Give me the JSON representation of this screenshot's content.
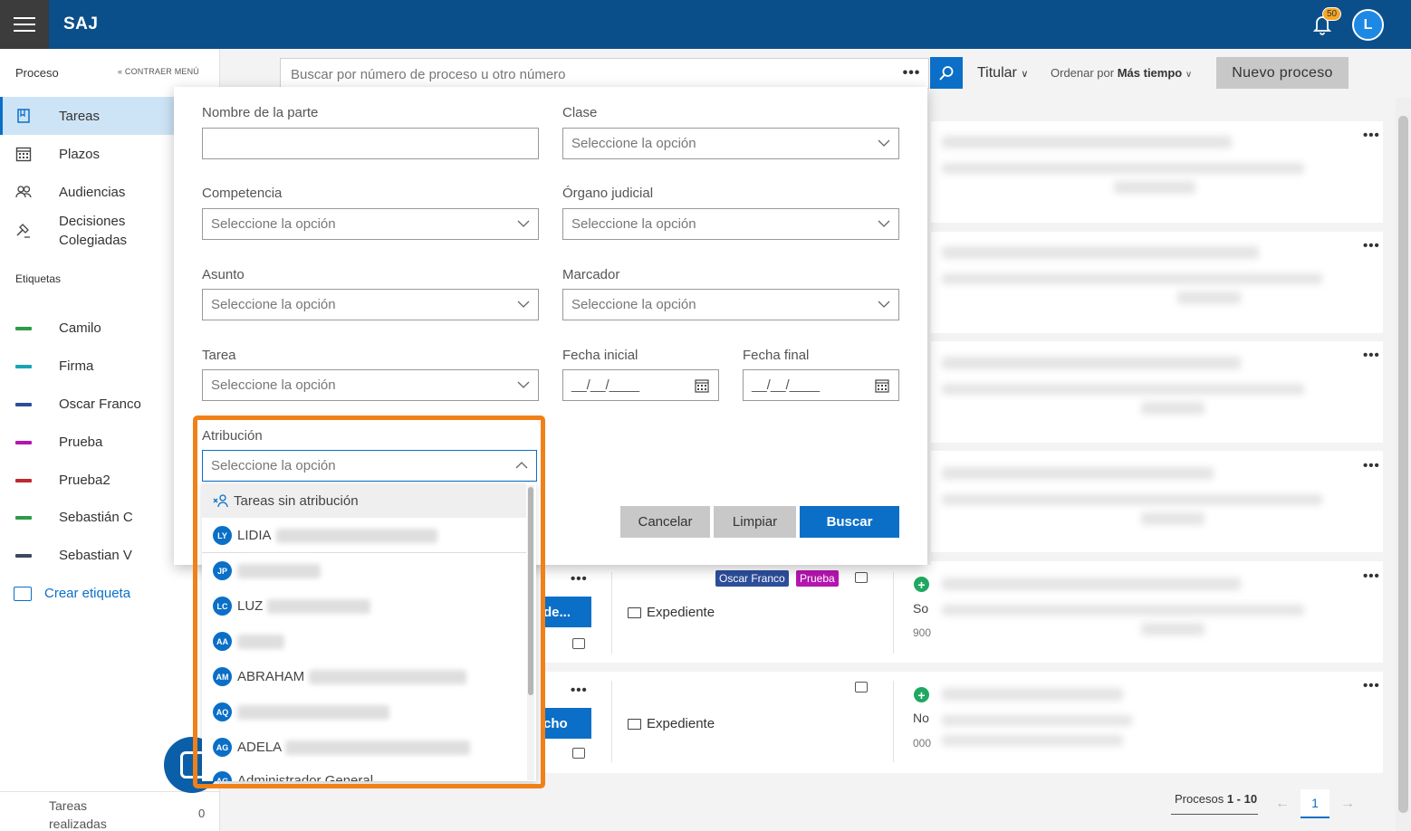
{
  "app": {
    "brand": "SAJ",
    "notifications": "50",
    "user_initial": "L"
  },
  "sidebar": {
    "title": "Proceso",
    "collapse_label": "CONTRAER MENÚ",
    "items": [
      {
        "label": "Tareas"
      },
      {
        "label": "Plazos"
      },
      {
        "label": "Audiencias"
      },
      {
        "label": "Decisiones Colegiadas"
      }
    ],
    "tags_title": "Etiquetas",
    "tags": [
      {
        "label": "Camilo",
        "color": "#2e9b4a"
      },
      {
        "label": "Firma",
        "color": "#1aa3b5"
      },
      {
        "label": "Oscar Franco",
        "color": "#2d4e9a"
      },
      {
        "label": "Prueba",
        "color": "#b515b0"
      },
      {
        "label": "Prueba2",
        "color": "#c0282e"
      },
      {
        "label": "Sebastián C",
        "color": "#2e9b4a"
      },
      {
        "label": "Sebastian V",
        "color": "#3b4a5e"
      }
    ],
    "create_tag": "Crear etiqueta",
    "done_label": "Tareas realizadas",
    "done_count": "0"
  },
  "toolbar": {
    "search_placeholder": "Buscar por número de proceso u otro número",
    "more": "•••",
    "titular": "Titular",
    "order_prefix": "Ordenar por",
    "order_value": "Más tiempo",
    "new_process": "Nuevo proceso"
  },
  "cards": {
    "kebab": "•••",
    "tag_a": "Oscar Franco",
    "tag_b": "Prueba",
    "expediente": "Expediente",
    "btn_a": "de...",
    "btn_b": "cho",
    "text_a": "So",
    "num_a": "900",
    "text_b": "No",
    "num_b": "000"
  },
  "pager": {
    "label": "Procesos",
    "range": "1 - 10",
    "page": "1",
    "prev": "←",
    "next": "→"
  },
  "modal": {
    "fields": {
      "party_name": {
        "label": "Nombre de la parte",
        "value": ""
      },
      "clase": {
        "label": "Clase",
        "placeholder": "Seleccione la opción"
      },
      "competencia": {
        "label": "Competencia",
        "placeholder": "Seleccione la opción"
      },
      "organo": {
        "label": "Órgano judicial",
        "placeholder": "Seleccione la opción"
      },
      "asunto": {
        "label": "Asunto",
        "placeholder": "Seleccione la opción"
      },
      "marcador": {
        "label": "Marcador",
        "placeholder": "Seleccione la opción"
      },
      "tarea": {
        "label": "Tarea",
        "placeholder": "Seleccione la opción"
      },
      "fecha_inicial": {
        "label": "Fecha inicial",
        "placeholder": "__/__/____"
      },
      "fecha_final": {
        "label": "Fecha final",
        "placeholder": "__/__/____"
      },
      "atribucion": {
        "label": "Atribución",
        "placeholder": "Seleccione la opción"
      }
    },
    "buttons": {
      "cancel": "Cancelar",
      "clear": "Limpiar",
      "search": "Buscar"
    },
    "dropdown": {
      "no_assignment": "Tareas sin atribución",
      "options": [
        {
          "initials": "LY",
          "name": "LIDIA"
        },
        {
          "initials": "JP",
          "name": ""
        },
        {
          "initials": "LC",
          "name": "LUZ"
        },
        {
          "initials": "AA",
          "name": ""
        },
        {
          "initials": "AM",
          "name": "ABRAHAM"
        },
        {
          "initials": "AQ",
          "name": ""
        },
        {
          "initials": "AG",
          "name": "ADELA"
        },
        {
          "initials": "AG",
          "name": "Administrador General"
        }
      ]
    }
  }
}
